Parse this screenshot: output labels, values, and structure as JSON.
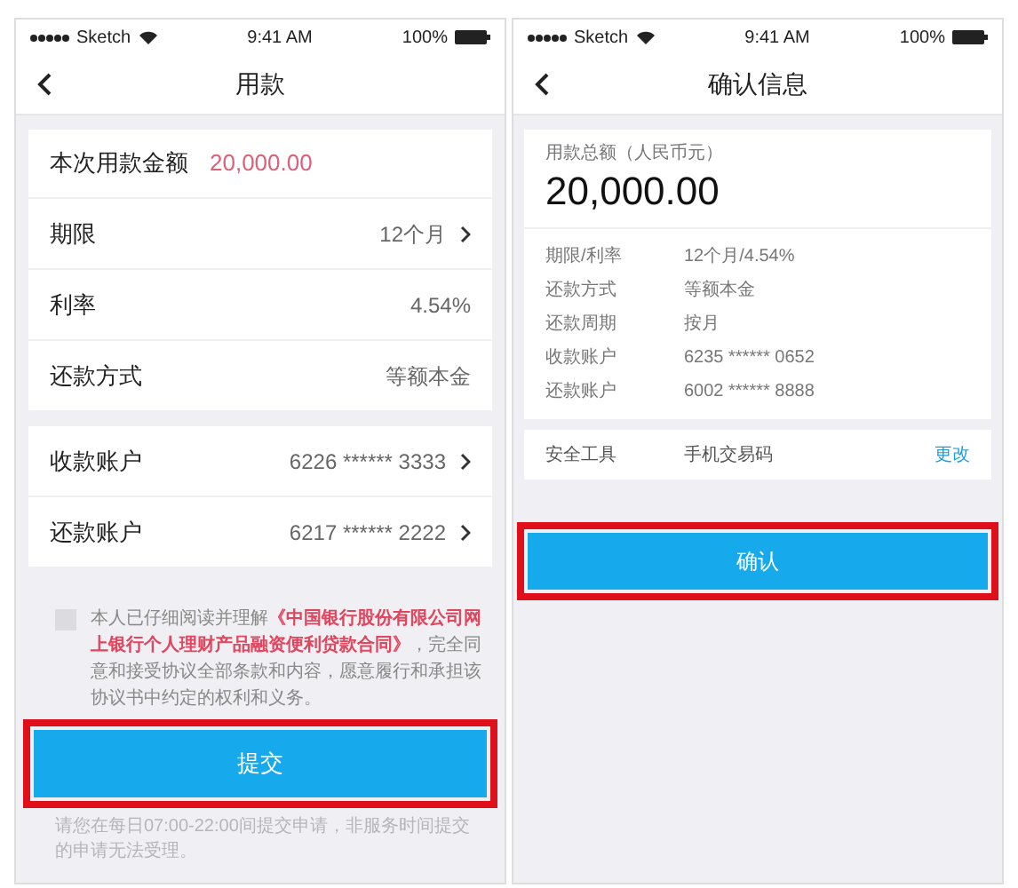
{
  "loan_screen": {
    "status_bar": {
      "carrier": "Sketch",
      "time": "9:41 AM",
      "battery": "100%"
    },
    "title": "用款",
    "amount": {
      "label": "本次用款金额",
      "value": "20,000.00"
    },
    "terms": [
      {
        "label": "期限",
        "value": "12个月",
        "chevron": true
      },
      {
        "label": "利率",
        "value": "4.54%",
        "chevron": false
      },
      {
        "label": "还款方式",
        "value": "等额本金",
        "chevron": false
      }
    ],
    "accounts": [
      {
        "label": "收款账户",
        "value": "6226 ****** 3333",
        "chevron": true
      },
      {
        "label": "还款账户",
        "value": "6217 ****** 2222",
        "chevron": true
      }
    ],
    "agreement": {
      "checked": false,
      "text": "本人已仔细阅读并理解**《中国银行股份有限公司网上银行个人理财产品融资便利贷款合同》**，完全同意和接受协议全部条款和内容，愿意履行和承担该协议书中约定的权利和义务。"
    },
    "submit_button": {
      "label": "提交",
      "highlighted": true
    },
    "notice": "请您在每日07:00-22:00间提交申请，非服务时间提交的申请无法受理。"
  },
  "confirm_screen": {
    "status_bar": {
      "carrier": "Sketch",
      "time": "9:41 AM",
      "battery": "100%"
    },
    "title": "确认信息",
    "total": {
      "label": "用款总额（人民币元）",
      "value": "20,000.00"
    },
    "details": [
      {
        "label": "期限/利率",
        "value": "12个月/4.54%"
      },
      {
        "label": "还款方式",
        "value": "等额本金"
      },
      {
        "label": "还款周期",
        "value": "按月"
      },
      {
        "label": "收款账户",
        "value": "6235 ****** 0652"
      },
      {
        "label": "还款账户",
        "value": "6002 ****** 8888"
      }
    ],
    "security": {
      "label": "安全工具",
      "value": "手机交易码",
      "action": "更改"
    },
    "confirm_button": {
      "label": "确认",
      "highlighted": true
    }
  }
}
